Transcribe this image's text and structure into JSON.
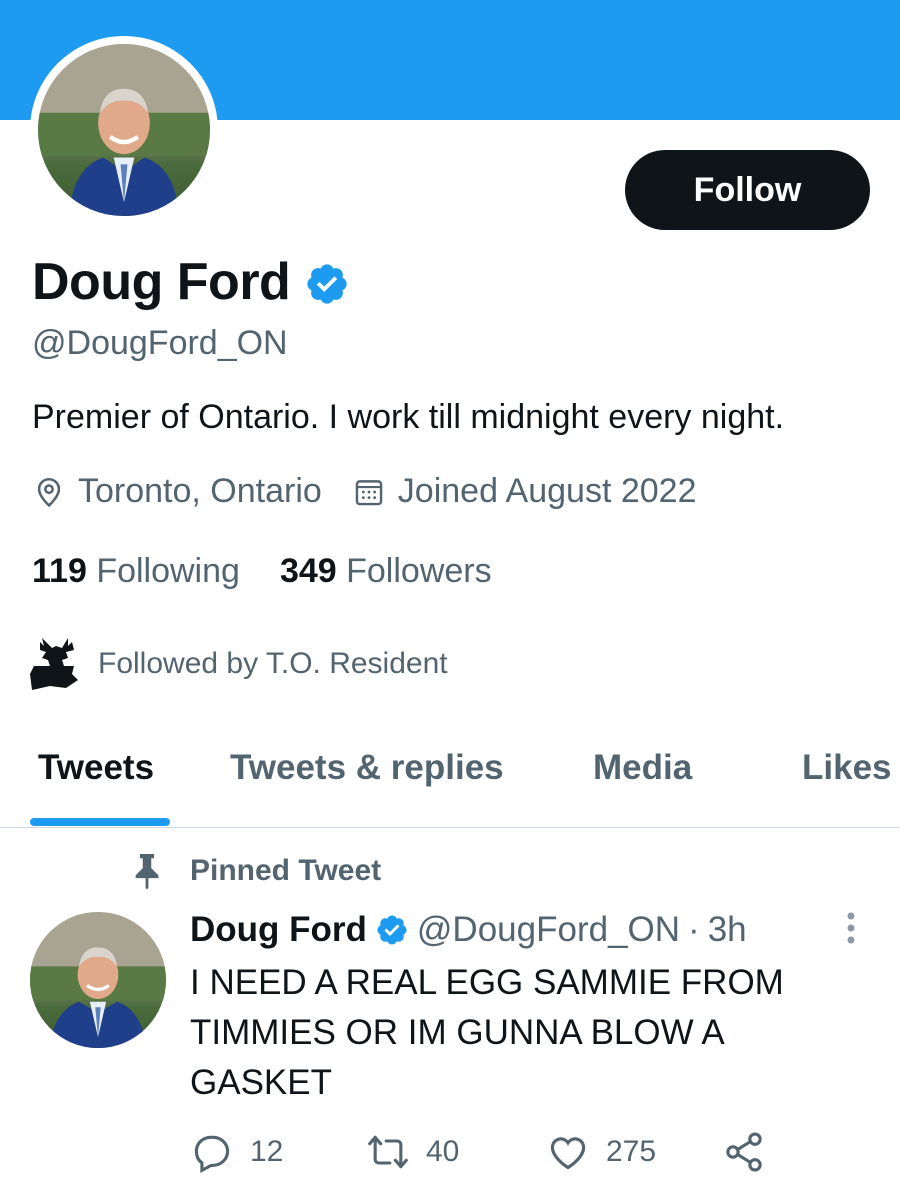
{
  "colors": {
    "banner": "#1d9bf0",
    "accent": "#1d9bf0",
    "primary_text": "#0f1419",
    "secondary_text": "#536471",
    "follow_button_bg": "#0f1419"
  },
  "profile": {
    "display_name": "Doug Ford",
    "handle": "@DougFord_ON",
    "bio": "Premier of Ontario. I work till midnight every night.",
    "location": "Toronto, Ontario",
    "joined": "Joined August 2022",
    "verified_icon": "verified-badge-icon",
    "follow_label": "Follow"
  },
  "stats": {
    "following_count": "119",
    "following_label": "Following",
    "followers_count": "349",
    "followers_label": "Followers"
  },
  "followed_by": {
    "text": "Followed by T.O. Resident",
    "avatar_icon": "moose-icon"
  },
  "tabs": [
    {
      "label": "Tweets",
      "active": true
    },
    {
      "label": "Tweets & replies",
      "active": false
    },
    {
      "label": "Media",
      "active": false
    },
    {
      "label": "Likes",
      "active": false
    }
  ],
  "pinned_tweet": {
    "pinned_label": "Pinned Tweet",
    "author_name": "Doug Ford",
    "author_handle": "@DougFord_ON",
    "separator": "·",
    "time": "3h",
    "text": "I NEED A REAL EGG SAMMIE FROM TIMMIES OR IM GUNNA BLOW A GASKET",
    "replies": "12",
    "retweets": "40",
    "likes": "275"
  }
}
